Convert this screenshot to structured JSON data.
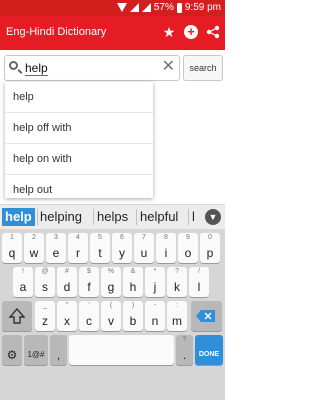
{
  "statusbar": {
    "battery": "57%",
    "time": "9:59 pm"
  },
  "appbar": {
    "title": "Eng-Hindi Dictionary"
  },
  "search": {
    "value": "help",
    "button_label": "search"
  },
  "dropdown": {
    "items": [
      "help",
      "help off with",
      "help on with",
      "help out"
    ]
  },
  "suggestions": [
    "help",
    "helping",
    "helps",
    "helpful",
    "l"
  ],
  "keyboard": {
    "row1": [
      {
        "n": "1",
        "c": "q"
      },
      {
        "n": "2",
        "c": "w"
      },
      {
        "n": "3",
        "c": "e"
      },
      {
        "n": "4",
        "c": "r"
      },
      {
        "n": "5",
        "c": "t"
      },
      {
        "n": "6",
        "c": "y"
      },
      {
        "n": "7",
        "c": "u"
      },
      {
        "n": "8",
        "c": "i"
      },
      {
        "n": "9",
        "c": "o"
      },
      {
        "n": "0",
        "c": "p"
      }
    ],
    "row2": [
      {
        "n": "!",
        "c": "a"
      },
      {
        "n": "@",
        "c": "s"
      },
      {
        "n": "#",
        "c": "d"
      },
      {
        "n": "$",
        "c": "f"
      },
      {
        "n": "%",
        "c": "g"
      },
      {
        "n": "&",
        "c": "h"
      },
      {
        "n": "*",
        "c": "j"
      },
      {
        "n": "?",
        "c": "k"
      },
      {
        "n": "/",
        "c": "l"
      }
    ],
    "row3": [
      {
        "n": "_",
        "c": "z"
      },
      {
        "n": "\"",
        "c": "x"
      },
      {
        "n": "'",
        "c": "c"
      },
      {
        "n": "(",
        "c": "v"
      },
      {
        "n": ")",
        "c": "b"
      },
      {
        "n": "-",
        "c": "n"
      },
      {
        "n": ":",
        "c": "m"
      }
    ],
    "row4": {
      "sym": "1@#",
      "comma": ",",
      "period": ".",
      "done": "DONE",
      "period_alt": "?"
    }
  }
}
